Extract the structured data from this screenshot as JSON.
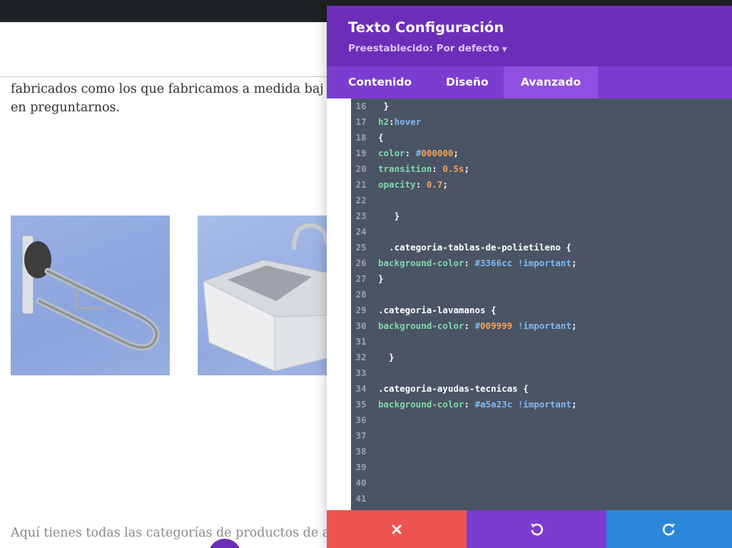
{
  "page": {
    "paragraph_lines": [
      "fabricados como los que fabricamos a medida baj",
      "en preguntarnos."
    ],
    "bottom_text": "Aquí tienes todas las categorías de productos de a"
  },
  "modal": {
    "title": "Texto Configuración",
    "preset": "Preestablecido: Por defecto",
    "tabs": [
      "Contenido",
      "Diseño",
      "Avanzado"
    ],
    "active_tab": "Avanzado",
    "code_lines": [
      {
        "n": "16",
        "code": " }"
      },
      {
        "n": "17",
        "code": "h2:hover"
      },
      {
        "n": "18",
        "code": "{"
      },
      {
        "n": "19",
        "code": "color: #000000;"
      },
      {
        "n": "20",
        "code": "transition: 0.5s;"
      },
      {
        "n": "21",
        "code": "opacity: 0.7;"
      },
      {
        "n": "22",
        "code": ""
      },
      {
        "n": "23",
        "code": "   }"
      },
      {
        "n": "24",
        "code": ""
      },
      {
        "n": "25",
        "code": "  .categoria-tablas-de-polietileno {"
      },
      {
        "n": "26",
        "code": "background-color: #3366cc !important;"
      },
      {
        "n": "27",
        "code": "}"
      },
      {
        "n": "28",
        "code": ""
      },
      {
        "n": "29",
        "code": ".categoria-lavamanos {"
      },
      {
        "n": "30",
        "code": "background-color: #009999 !important;"
      },
      {
        "n": "31",
        "code": ""
      },
      {
        "n": "32",
        "code": "  }"
      },
      {
        "n": "33",
        "code": ""
      },
      {
        "n": "34",
        "code": ".categoria-ayudas-tecnicas {"
      },
      {
        "n": "35",
        "code": "background-color: #a5a23c !important;"
      },
      {
        "n": "36",
        "code": ""
      },
      {
        "n": "37",
        "code": ""
      },
      {
        "n": "38",
        "code": ""
      },
      {
        "n": "39",
        "code": ""
      },
      {
        "n": "40",
        "code": ""
      },
      {
        "n": "41",
        "code": ""
      }
    ],
    "footer_icons": [
      "close-icon",
      "undo-icon",
      "redo-icon"
    ]
  },
  "colors": {
    "modal_header": "#6c2eb9",
    "tab_bar": "#7b3cd0",
    "active_tab": "#8f4fe0",
    "editor_bg": "#4a5464",
    "cancel": "#ef5350",
    "undo": "#7b3cd0",
    "redo": "#2b87da"
  }
}
